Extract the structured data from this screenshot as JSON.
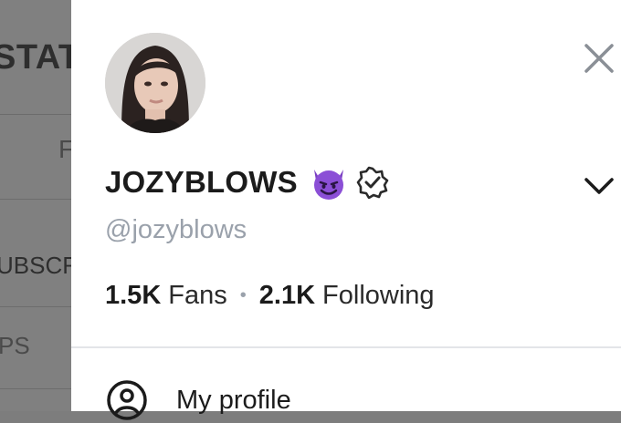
{
  "background": {
    "title_fragment": "STAT",
    "tab_fragment": "F",
    "row_fragment": "UBSCR",
    "row2_fragment": "PS"
  },
  "profile": {
    "name": "JOZYBLOWS",
    "handle": "@jozyblows",
    "emoji_icon": "smiling-devil-icon",
    "verified_icon": "verified-badge-icon"
  },
  "stats": {
    "fans_count": "1.5K",
    "fans_label": "Fans",
    "separator": "•",
    "following_count": "2.1K",
    "following_label": "Following"
  },
  "menu": {
    "items": [
      {
        "label": "My profile",
        "icon": "user-circle-icon"
      }
    ]
  },
  "colors": {
    "drawer_bg": "#ffffff",
    "overlay": "#808080",
    "muted_text": "#9aa1ab",
    "primary_text": "#1b1b1b",
    "emoji_purple": "#8b4fd6"
  }
}
